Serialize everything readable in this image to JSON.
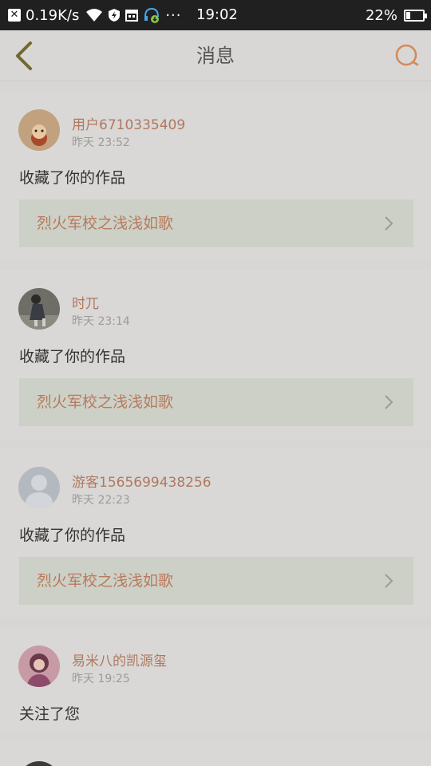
{
  "status_bar": {
    "net_speed": "0.19K/s",
    "time": "19:02",
    "battery": "22%",
    "battery_level": 0.22,
    "dots": "···",
    "notif_x": "✕"
  },
  "header": {
    "title": "消息"
  },
  "messages": [
    {
      "user": "用户6710335409",
      "time": "昨天 23:52",
      "action": "收藏了你的作品",
      "work": "烈火军校之浅浅如歌"
    },
    {
      "user": "时兀",
      "time": "昨天 23:14",
      "action": "收藏了你的作品",
      "work": "烈火军校之浅浅如歌"
    },
    {
      "user": "游客1565699438256",
      "time": "昨天 22:23",
      "action": "收藏了你的作品",
      "work": "烈火军校之浅浅如歌"
    },
    {
      "user": "易米八的凯源玺",
      "time": "昨天 19:25",
      "action": "关注了您",
      "work": ""
    }
  ],
  "colors": {
    "accent": "#b07860",
    "accent_icon": "#d28a5a",
    "back_arrow": "#6e6a30"
  }
}
